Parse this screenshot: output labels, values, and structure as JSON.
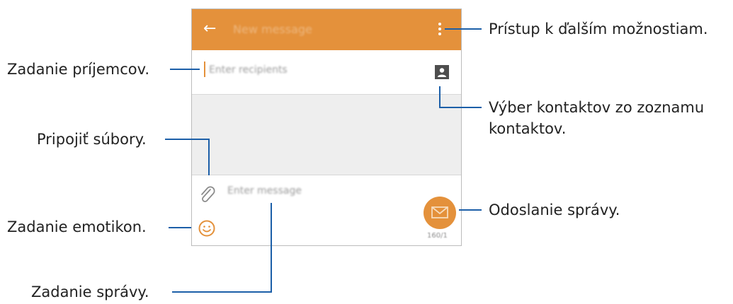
{
  "app": {
    "back_glyph": "←",
    "title": "New message",
    "recipients_placeholder": "Enter recipients",
    "message_placeholder": "Enter message",
    "counter": "160/1"
  },
  "callouts": {
    "more_options": "Prístup k ďalším možnostiam.",
    "recipients": "Zadanie príjemcov.",
    "contacts_line1": "Výber kontaktov zo zoznamu",
    "contacts_line2": "kontaktov.",
    "attach": "Pripojiť súbory.",
    "emoticons": "Zadanie emotikon.",
    "send": "Odoslanie správy.",
    "message": "Zadanie správy."
  },
  "icons": {
    "back": "arrow-left-icon",
    "more": "more-vertical-icon",
    "contacts": "contact-card-icon",
    "attach": "paperclip-icon",
    "emoji": "smiley-icon",
    "send": "envelope-icon"
  },
  "colors": {
    "accent": "#e4913b",
    "callout_line": "#1c5fa8"
  }
}
